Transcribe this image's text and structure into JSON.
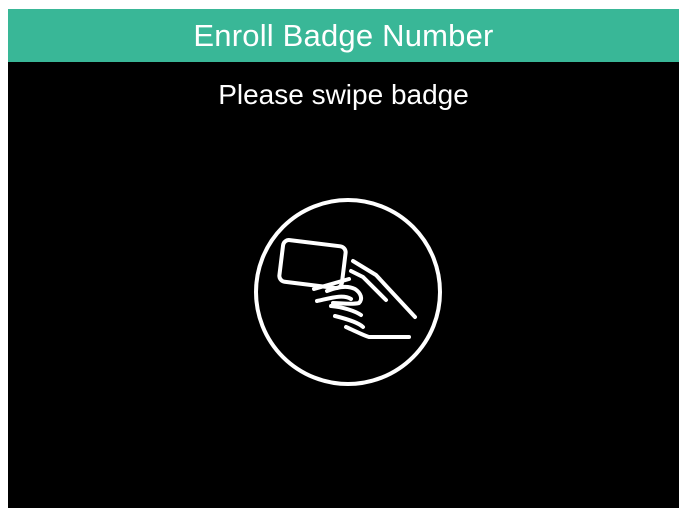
{
  "colors": {
    "header_background": "#39b797",
    "screen_background": "#000000",
    "text": "#ffffff",
    "icon_stroke": "#ffffff"
  },
  "header": {
    "title": "Enroll Badge Number"
  },
  "main": {
    "prompt": "Please swipe badge",
    "icon": "badge-swipe-icon"
  }
}
